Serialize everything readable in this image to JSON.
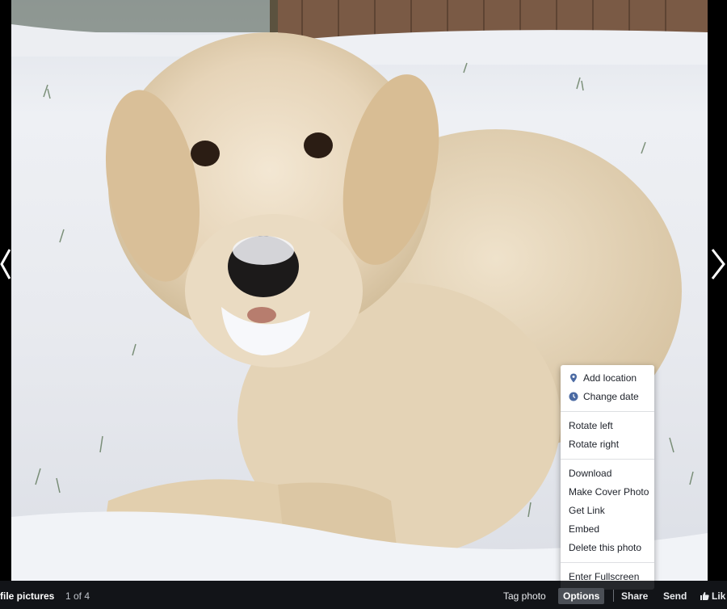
{
  "footer": {
    "album_title": "file pictures",
    "photo_count": "1 of 4",
    "tag_photo": "Tag photo",
    "options": "Options",
    "share": "Share",
    "send": "Send",
    "like": "Lik"
  },
  "menu": {
    "add_location": "Add location",
    "change_date": "Change date",
    "rotate_left": "Rotate left",
    "rotate_right": "Rotate right",
    "download": "Download",
    "make_cover_photo": "Make Cover Photo",
    "get_link": "Get Link",
    "embed": "Embed",
    "delete_photo": "Delete this photo",
    "enter_fullscreen": "Enter Fullscreen"
  },
  "colors": {
    "menu_icon": "#4b6aa3",
    "bar_background": "#14161a",
    "options_highlight": "#4b4f56"
  }
}
